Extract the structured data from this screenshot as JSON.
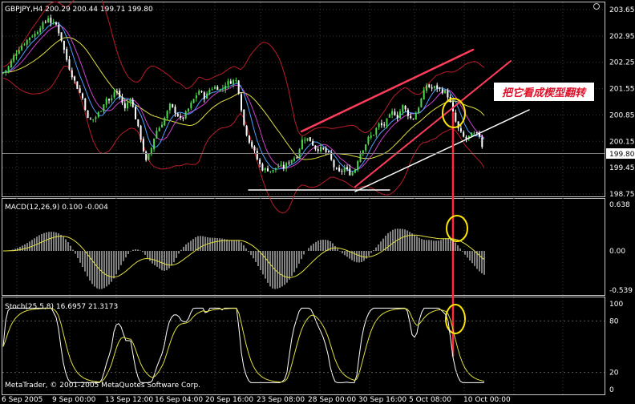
{
  "chart_data": {
    "type": "candlestick",
    "symbol_header": "GBPJPY,H4  200.29 200.44 199.71 199.80",
    "annotation": "把它看成楔型翻转",
    "copyright": "MetaTrader, © 2001-2005 MetaQuotes Software Corp.",
    "x_tick_labels": [
      "6 Sep 2005",
      "9 Sep 00:00",
      "13 Sep 12:00",
      "16 Sep 04:00",
      "20 Sep 16:00",
      "23 Sep 08:00",
      "28 Sep 00:00",
      "30 Sep 16:00",
      "5 Oct 08:00",
      "10 Oct 00:00"
    ],
    "price_panel": {
      "ylim": [
        198.75,
        203.65
      ],
      "y_ticks": [
        203.65,
        202.95,
        202.25,
        201.55,
        200.85,
        200.15,
        199.45,
        198.75
      ],
      "last_price": 199.8,
      "close_path": [
        [
          0,
          201.9
        ],
        [
          10,
          202.1
        ],
        [
          18,
          202.45
        ],
        [
          25,
          202.65
        ],
        [
          32,
          202.8
        ],
        [
          38,
          202.95
        ],
        [
          44,
          203.0
        ],
        [
          50,
          203.2
        ],
        [
          56,
          203.3
        ],
        [
          60,
          203.45
        ],
        [
          64,
          203.3
        ],
        [
          70,
          203.25
        ],
        [
          76,
          202.9
        ],
        [
          82,
          202.4
        ],
        [
          88,
          202.0
        ],
        [
          96,
          201.6
        ],
        [
          104,
          201.25
        ],
        [
          110,
          200.7
        ],
        [
          118,
          200.75
        ],
        [
          126,
          201.0
        ],
        [
          132,
          201.3
        ],
        [
          138,
          201.2
        ],
        [
          144,
          201.55
        ],
        [
          150,
          201.3
        ],
        [
          156,
          201.0
        ],
        [
          162,
          201.35
        ],
        [
          168,
          200.85
        ],
        [
          176,
          200.2
        ],
        [
          182,
          199.6
        ],
        [
          188,
          199.9
        ],
        [
          194,
          200.4
        ],
        [
          200,
          200.55
        ],
        [
          206,
          200.8
        ],
        [
          212,
          201.1
        ],
        [
          220,
          200.9
        ],
        [
          226,
          200.7
        ],
        [
          232,
          200.9
        ],
        [
          240,
          201.2
        ],
        [
          248,
          201.5
        ],
        [
          256,
          201.3
        ],
        [
          262,
          201.55
        ],
        [
          270,
          201.6
        ],
        [
          276,
          201.5
        ],
        [
          282,
          201.7
        ],
        [
          290,
          201.75
        ],
        [
          294,
          201.8
        ],
        [
          298,
          201.45
        ],
        [
          304,
          200.6
        ],
        [
          310,
          200.2
        ],
        [
          316,
          199.95
        ],
        [
          322,
          199.6
        ],
        [
          328,
          199.4
        ],
        [
          334,
          199.4
        ],
        [
          340,
          199.35
        ],
        [
          346,
          199.5
        ],
        [
          354,
          199.45
        ],
        [
          362,
          199.65
        ],
        [
          370,
          199.75
        ],
        [
          378,
          200.25
        ],
        [
          386,
          200.2
        ],
        [
          394,
          199.95
        ],
        [
          402,
          199.95
        ],
        [
          410,
          199.8
        ],
        [
          418,
          199.4
        ],
        [
          424,
          199.3
        ],
        [
          430,
          199.45
        ],
        [
          436,
          199.3
        ],
        [
          442,
          199.35
        ],
        [
          448,
          199.8
        ],
        [
          454,
          200.0
        ],
        [
          460,
          200.25
        ],
        [
          466,
          200.35
        ],
        [
          472,
          200.6
        ],
        [
          478,
          200.55
        ],
        [
          484,
          200.75
        ],
        [
          490,
          200.95
        ],
        [
          496,
          200.8
        ],
        [
          502,
          201.1
        ],
        [
          508,
          200.9
        ],
        [
          514,
          200.7
        ],
        [
          520,
          200.95
        ],
        [
          526,
          201.3
        ],
        [
          532,
          201.65
        ],
        [
          538,
          201.55
        ],
        [
          544,
          201.6
        ],
        [
          550,
          201.5
        ],
        [
          556,
          201.45
        ],
        [
          560,
          201.3
        ],
        [
          566,
          200.8
        ],
        [
          572,
          200.45
        ],
        [
          580,
          200.2
        ],
        [
          590,
          200.35
        ],
        [
          598,
          200.3
        ],
        [
          604,
          199.8
        ]
      ]
    },
    "macd_panel": {
      "label": "MACD(12,26,9) 0.100 -0.004",
      "ylim": [
        -0.539,
        0.638
      ],
      "y_ticks": [
        0.638,
        0.0,
        -0.539
      ]
    },
    "stoch_panel": {
      "label": "Stoch(25,5,8) 16.6957 21.3173",
      "ylim": [
        0,
        100
      ],
      "y_ticks": [
        100,
        80,
        20,
        0
      ]
    }
  }
}
